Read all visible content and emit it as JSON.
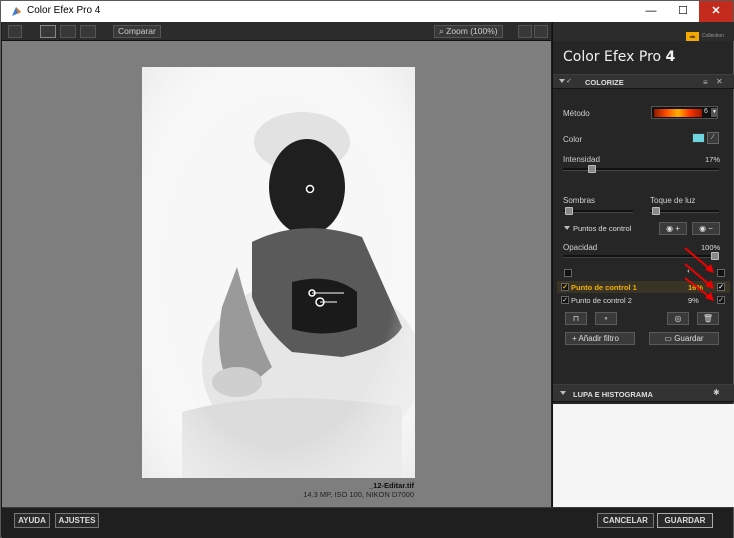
{
  "window": {
    "title": "Color Efex Pro 4",
    "min": "—",
    "max": "☐",
    "close": "✕"
  },
  "toolbar": {
    "compare_label": "Comparar",
    "zoom_label": "Zoom (100%)"
  },
  "file": {
    "name": "_12-Editar.tif",
    "info": "14.3 MP, ISO 100, NIKON D7000"
  },
  "panel": {
    "brand_name": "Color Efex Pro",
    "brand_num": "4",
    "badge": "nik",
    "badge_text": "Collection",
    "filter_title": "COLORIZE",
    "method_label": "Método",
    "method_value": "6",
    "color_label": "Color",
    "color_swatch": "#6fd3e0",
    "intensity_label": "Intensidad",
    "intensity_value": "17%",
    "intensity_level": 0.17,
    "shadows_label": "Sombras",
    "highlights_label": "Toque de luz",
    "control_points_label": "Puntos de control",
    "opacity_label": "Opacidad",
    "opacity_value": "100%",
    "control_points": [
      {
        "name": "Punto de control 1",
        "pct": "16%"
      },
      {
        "name": "Punto de control 2",
        "pct": "9%"
      }
    ],
    "add_filter": "Añadir filtro",
    "save": "Guardar",
    "loupe_title": "LUPA E HISTOGRAMA"
  },
  "bottom": {
    "help": "AYUDA",
    "settings": "AJUSTES",
    "cancel": "CANCELAR",
    "save": "GUARDAR"
  }
}
